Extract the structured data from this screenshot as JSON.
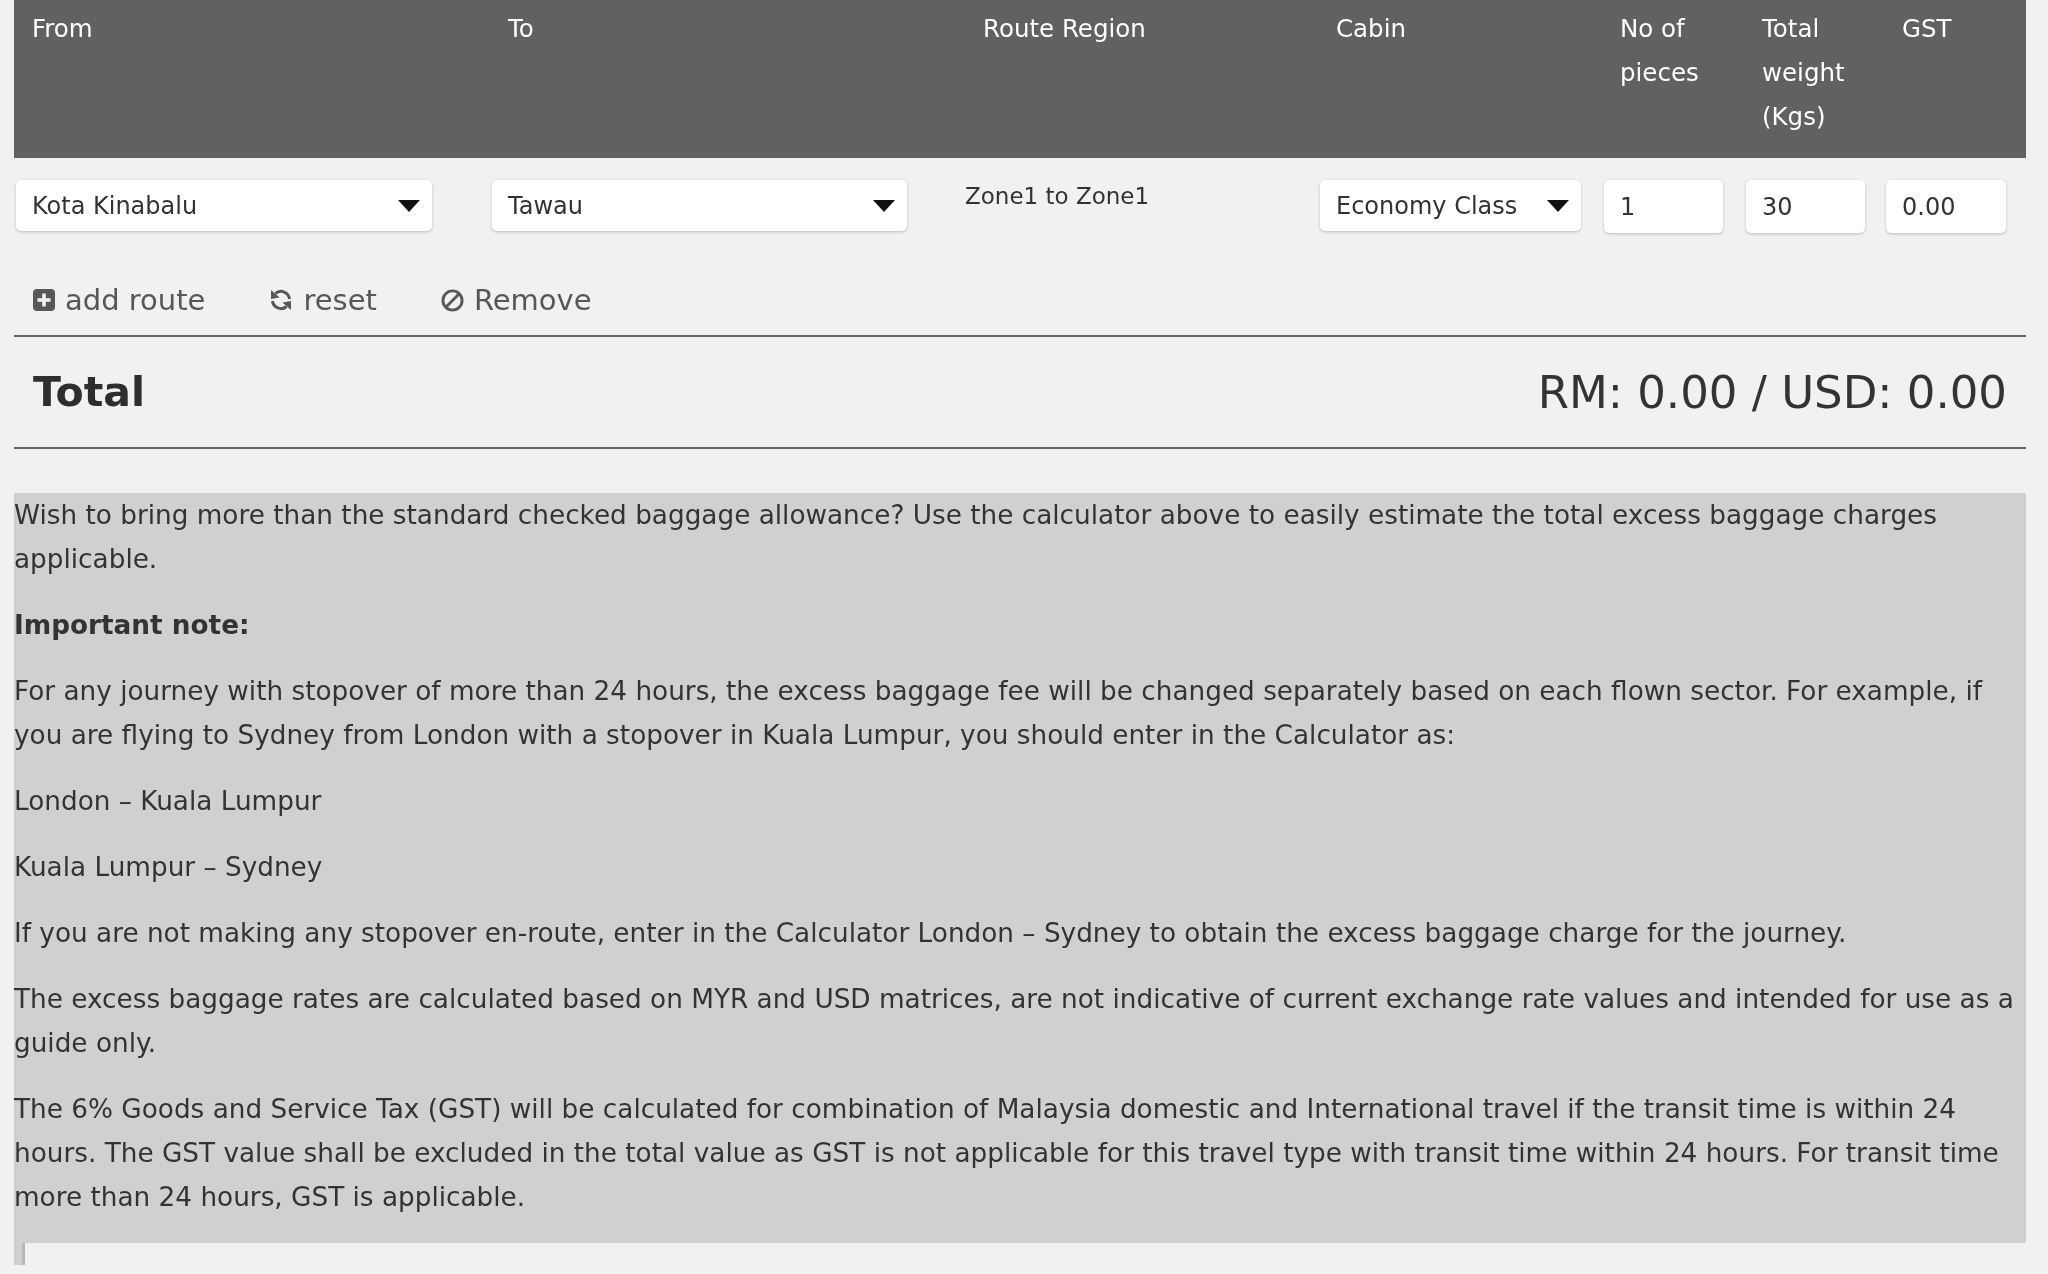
{
  "route_table": {
    "columns": [
      {
        "label": "From"
      },
      {
        "label": "To"
      },
      {
        "label": "Route Region"
      },
      {
        "label": "Cabin"
      },
      {
        "label": "No of pieces"
      },
      {
        "label": "Total weight (Kgs)"
      },
      {
        "label": "GST"
      }
    ],
    "rows": [
      {
        "cells": [
          {
            "kind": "select",
            "value": "Kota Kinabalu"
          },
          {
            "kind": "select",
            "value": "Tawau"
          },
          {
            "kind": "text",
            "value": "Zone1 to Zone1"
          },
          {
            "kind": "select",
            "value": "Economy Class"
          },
          {
            "kind": "input",
            "value": "1"
          },
          {
            "kind": "input",
            "value": "30"
          },
          {
            "kind": "input",
            "value": "0.00"
          }
        ]
      }
    ]
  },
  "actions": [
    {
      "kind": "add",
      "label": "add route"
    },
    {
      "kind": "reset",
      "label": "reset"
    },
    {
      "kind": "remove",
      "label": "Remove"
    }
  ],
  "total": {
    "label": "Total",
    "value": "RM: 0.00 / USD: 0.00"
  },
  "info": {
    "paragraphs": [
      {
        "kind": "text",
        "text": "Wish to bring more than the standard checked baggage allowance? Use the calculator above to easily estimate the total excess baggage charges applicable."
      },
      {
        "kind": "heading",
        "text": "Important note:"
      },
      {
        "kind": "text",
        "text": "For any journey with stopover of more than 24 hours, the excess baggage fee will be changed separately based on each flown sector. For example, if you are flying to Sydney from London with a stopover in Kuala Lumpur, you should enter in the Calculator as:"
      },
      {
        "kind": "text",
        "text": "London – Kuala Lumpur"
      },
      {
        "kind": "text",
        "text": "Kuala Lumpur – Sydney"
      },
      {
        "kind": "text",
        "text": "If you are not making any stopover en-route, enter in the Calculator London – Sydney to obtain the excess baggage charge for the journey."
      },
      {
        "kind": "text",
        "text": "The excess baggage rates are calculated based on MYR and USD matrices, are not indicative of current exchange rate values and intended for use as a guide only."
      },
      {
        "kind": "text",
        "text": "The 6% Goods and Service Tax (GST) will be calculated for combination of Malaysia domestic and International travel if the transit time is within 24 hours. The GST value shall be excluded in the total value as GST is not applicable for this travel type with transit time within 24 hours. For transit time more than 24 hours, GST is applicable."
      }
    ]
  }
}
